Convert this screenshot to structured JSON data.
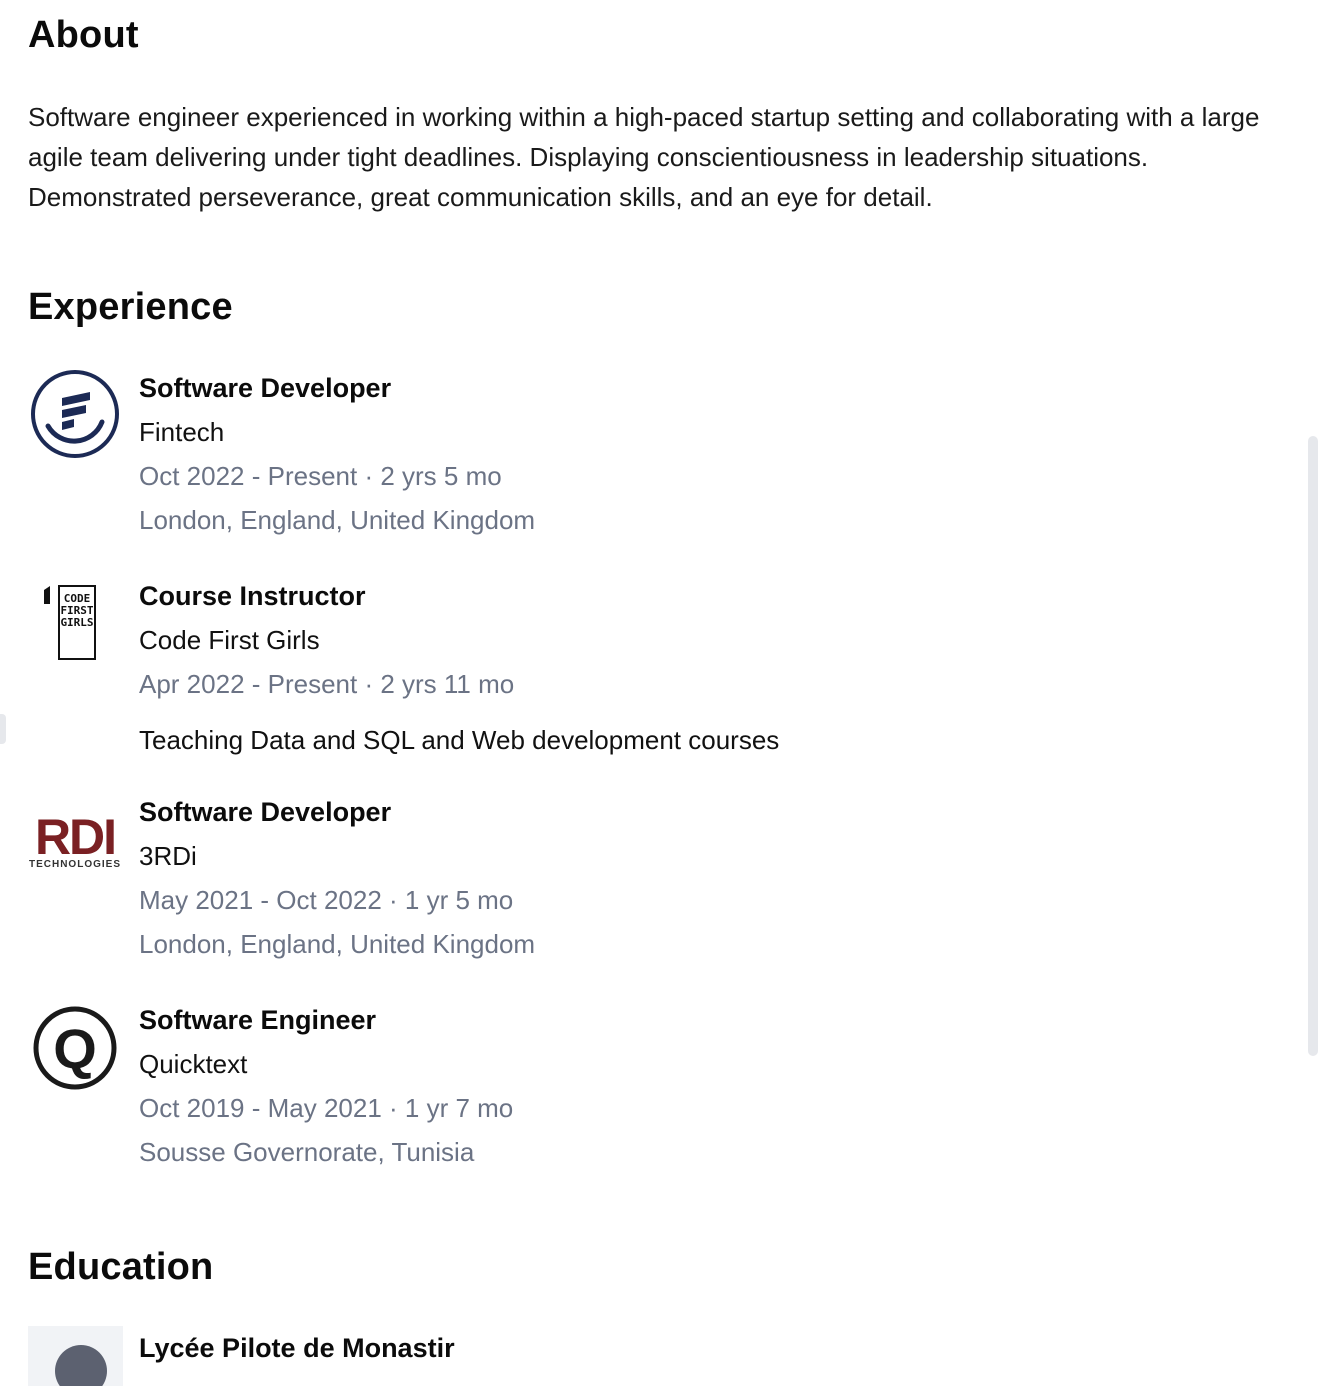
{
  "about": {
    "title": "About",
    "text": "Software engineer experienced in working within a high-paced startup setting and collaborating with a large agile team delivering under tight deadlines. Displaying conscientiousness in leadership situations. Demonstrated perseverance, great communication skills, and an eye for detail."
  },
  "experience": {
    "title": "Experience",
    "items": [
      {
        "role": "Software Developer",
        "company": "Fintech",
        "dates": "Oct 2022 - Present · 2 yrs 5 mo",
        "location": "London, England, United Kingdom",
        "logo_icon": "fintech-logo-icon",
        "logo_color": "#1c2a55"
      },
      {
        "role": "Course Instructor",
        "company": "Code First Girls",
        "dates": "Apr 2022 - Present · 2 yrs 11 mo",
        "description": "Teaching Data and SQL and Web development courses",
        "logo_icon": "code-first-girls-logo-icon",
        "logo_text": [
          "CODE",
          "FIRST",
          "GIRLS"
        ]
      },
      {
        "role": "Software Developer",
        "company": "3RDi",
        "dates": "May 2021 - Oct 2022 · 1 yr 5 mo",
        "location": "London, England, United Kingdom",
        "logo_icon": "rdi-technologies-logo-icon",
        "logo_text": [
          "RDI",
          "TECHNOLOGIES"
        ],
        "logo_color": "#7a2023"
      },
      {
        "role": "Software Engineer",
        "company": "Quicktext",
        "dates": "Oct 2019 - May 2021 · 1 yr 7 mo",
        "location": "Sousse Governorate, Tunisia",
        "logo_icon": "quicktext-logo-icon",
        "logo_text": [
          "Q"
        ]
      }
    ]
  },
  "education": {
    "title": "Education",
    "items": [
      {
        "school": "Lycée Pilote de Monastir",
        "logo_icon": "school-placeholder-icon"
      }
    ]
  },
  "colors": {
    "meta_text": "#6b7385",
    "heading": "#0b0b0b"
  }
}
